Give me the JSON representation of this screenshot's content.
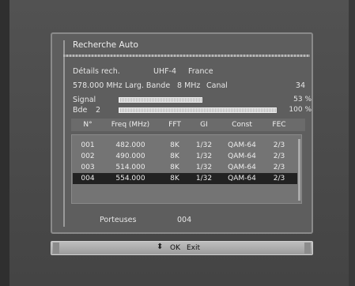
{
  "dialog": {
    "title": "Recherche Auto",
    "details_label": "Détails rech.",
    "channel": "UHF-4",
    "country": "France",
    "frequency": "578.000",
    "frequency_unit": "MHz",
    "bandwidth_label": "Larg. Bande",
    "bandwidth_value": "8 MHz",
    "canal_label": "Canal",
    "canal_value": "34",
    "signal_label": "Signal",
    "signal_pct": "53 %",
    "signal_level": 0.53,
    "bde_label": "Bde",
    "bde_num": "2",
    "bde_pct": "100 %",
    "bde_level": 1.0,
    "porteuses_label": "Porteuses",
    "porteuses_value": "004"
  },
  "table": {
    "headers": [
      "N°",
      "Freq (MHz)",
      "FFT",
      "GI",
      "Const",
      "FEC"
    ],
    "rows": [
      [
        "001",
        "482.000",
        "8K",
        "1/32",
        "QAM-64",
        "2/3"
      ],
      [
        "002",
        "490.000",
        "8K",
        "1/32",
        "QAM-64",
        "2/3"
      ],
      [
        "003",
        "514.000",
        "8K",
        "1/32",
        "QAM-64",
        "2/3"
      ],
      [
        "004",
        "554.000",
        "8K",
        "1/32",
        "QAM-64",
        "2/3"
      ]
    ],
    "selected_row": 4
  },
  "helpbar": {
    "arrows": "⬍",
    "ok": "OK",
    "exit": "Exit"
  }
}
